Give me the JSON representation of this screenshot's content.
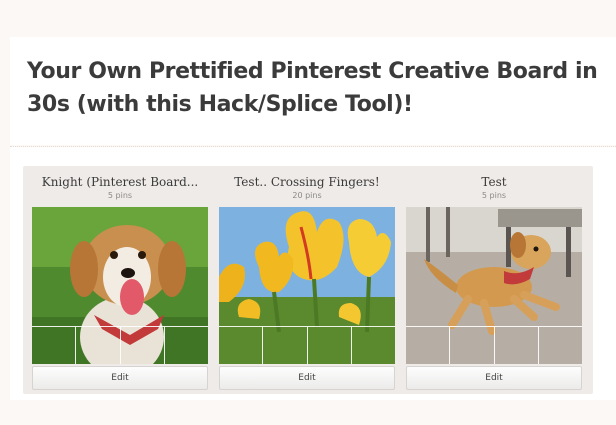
{
  "post": {
    "title": "Your Own Prettified Pinterest Creative Board in 30s (with this Hack/Splice Tool)!"
  },
  "boards": [
    {
      "name": "Knight (Pinterest Board...",
      "pins": "5 pins",
      "edit_label": "Edit",
      "cover_icon": "dog-photo"
    },
    {
      "name": "Test.. Crossing Fingers!",
      "pins": "20 pins",
      "edit_label": "Edit",
      "cover_icon": "tulips-photo"
    },
    {
      "name": "Test",
      "pins": "5 pins",
      "edit_label": "Edit",
      "cover_icon": "running-dog-photo"
    }
  ],
  "colors": {
    "page_bg": "#fbf8f5",
    "strip_bg": "#efebe8",
    "title": "#3b3b3b"
  }
}
